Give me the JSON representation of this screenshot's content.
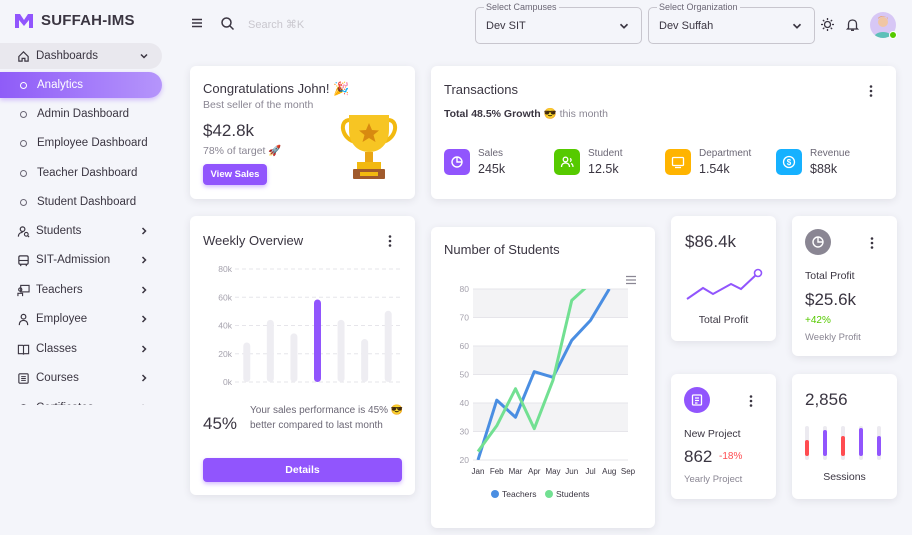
{
  "brand": {
    "name": "SUFFAH-IMS"
  },
  "sidebar": {
    "items": [
      {
        "label": "Dashboards",
        "icon": "home-icon"
      },
      {
        "label": "Analytics"
      },
      {
        "label": "Admin Dashboard"
      },
      {
        "label": "Employee Dashboard"
      },
      {
        "label": "Teacher Dashboard"
      },
      {
        "label": "Student Dashboard"
      },
      {
        "label": "Students",
        "icon": "user-search-icon"
      },
      {
        "label": "SIT-Admission",
        "icon": "bus-icon"
      },
      {
        "label": "Teachers",
        "icon": "teacher-icon"
      },
      {
        "label": "Employee",
        "icon": "employee-icon"
      },
      {
        "label": "Classes",
        "icon": "book-icon"
      },
      {
        "label": "Courses",
        "icon": "list-box-icon"
      },
      {
        "label": "Certificates",
        "icon": "certificate-icon"
      }
    ]
  },
  "topbar": {
    "search_placeholder": "Search ⌘K",
    "campus": {
      "label": "Select Campuses",
      "value": "Dev SIT"
    },
    "organization": {
      "label": "Select Organization",
      "value": "Dev Suffah"
    }
  },
  "congrats": {
    "title": "Congratulations John! 🎉",
    "subtitle": "Best seller of the month",
    "amount": "$42.8k",
    "target": "78% of target 🚀",
    "button": "View Sales"
  },
  "transactions": {
    "title": "Transactions",
    "growth_bold": "Total 48.5% Growth",
    "growth_rest": "😎 this month",
    "stats": [
      {
        "label": "Sales",
        "value": "245k",
        "color": "#9155fd",
        "icon": "trending-up-icon"
      },
      {
        "label": "Student",
        "value": "12.5k",
        "color": "#56ca00",
        "icon": "account-icon"
      },
      {
        "label": "Department",
        "value": "1.54k",
        "color": "#ffb400",
        "icon": "cellphone-icon"
      },
      {
        "label": "Revenue",
        "value": "$88k",
        "color": "#16b1ff",
        "icon": "currency-icon"
      }
    ]
  },
  "weekly": {
    "title": "Weekly Overview",
    "yticks": [
      "80k",
      "60k",
      "40k",
      "20k",
      "0k"
    ],
    "bars": [
      0.35,
      0.55,
      0.43,
      0.73,
      0.55,
      0.38,
      0.63
    ],
    "highlight_index": 3,
    "percent": "45%",
    "description": "Your sales performance is 45% 😎 better compared to last month",
    "button": "Details"
  },
  "students_chart": {
    "title": "Number of Students",
    "chart_data": {
      "type": "line",
      "categories": [
        "Jan",
        "Feb",
        "Mar",
        "Apr",
        "May",
        "Jun",
        "Jul",
        "Aug",
        "Sep"
      ],
      "ylim": [
        20,
        80
      ],
      "yticks": [
        "80",
        "70",
        "60",
        "50",
        "40",
        "30",
        "20"
      ],
      "series": [
        {
          "name": "Teachers",
          "color": "#4a8ee2",
          "values": [
            20,
            41,
            35,
            51,
            49,
            62,
            69,
            80,
            null
          ]
        },
        {
          "name": "Students",
          "color": "#72e092",
          "values": [
            23,
            32,
            45,
            31,
            48,
            76,
            82,
            null,
            null
          ]
        }
      ]
    }
  },
  "total_profit_card": {
    "value": "$86.4k",
    "label": "Total Profit"
  },
  "profit_card": {
    "label": "Total Profit",
    "value": "$25.6k",
    "change": "+42%",
    "sub": "Weekly Profit"
  },
  "new_project": {
    "label": "New Project",
    "value": "862",
    "change": "-18%",
    "sub": "Yearly Project"
  },
  "sessions": {
    "value": "2,856",
    "label": "Sessions"
  }
}
